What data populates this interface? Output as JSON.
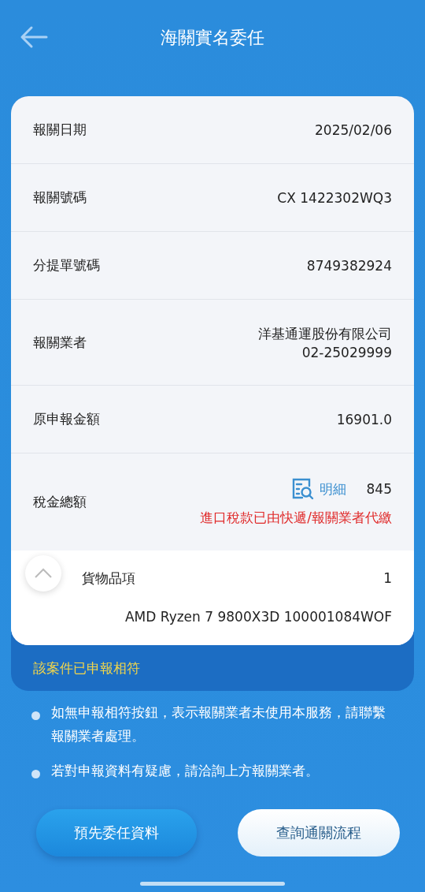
{
  "header": {
    "title": "海關實名委任"
  },
  "fields": [
    {
      "kind": "plain",
      "label": "報關日期",
      "value": "2025/02/06"
    },
    {
      "kind": "plain",
      "label": "報關號碼",
      "value": "CX  1422302WQ3"
    },
    {
      "kind": "plain",
      "label": "分提單號碼",
      "value": "8749382924"
    },
    {
      "kind": "multiline",
      "label": "報關業者",
      "lines": [
        "洋基通運股份有限公司",
        "02-25029999"
      ]
    },
    {
      "kind": "plain",
      "label": "原申報金額",
      "value": "16901.0"
    },
    {
      "kind": "tax",
      "label": "稅金總額",
      "link": "明細",
      "value": "845",
      "note": "進口稅款已由快遞/報關業者代繳"
    }
  ],
  "goods": {
    "expanded": true,
    "label": "貨物品項",
    "count": "1",
    "description": "AMD Ryzen 7 9800X3D 100001084WOF"
  },
  "status": "該案件已申報相符",
  "notes": [
    "如無申報相符按鈕，表示報關業者未使用本服務，請聯繫報關業者處理。",
    "若對申報資料有疑慮，請洽詢上方報關業者。"
  ],
  "buttons": [
    {
      "kind": "primary",
      "label": "預先委任資料"
    },
    {
      "kind": "secondary",
      "label": "查詢通關流程"
    }
  ]
}
